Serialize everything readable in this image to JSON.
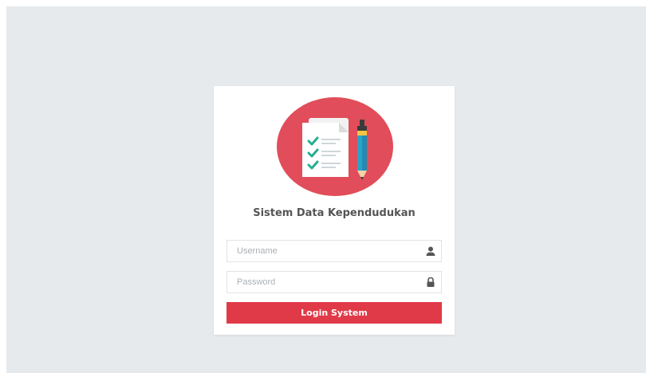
{
  "app": {
    "title": "Sistem Data Kependudukan"
  },
  "logo": {
    "icon": "checklist-pencil-icon",
    "color": "#e14d5a"
  },
  "form": {
    "username": {
      "placeholder": "Username",
      "value": "",
      "icon": "user-icon"
    },
    "password": {
      "placeholder": "Password",
      "value": "",
      "icon": "lock-icon"
    },
    "submit_label": "Login System"
  },
  "colors": {
    "accent": "#e03a48",
    "background": "#e6eaed",
    "card": "#ffffff"
  }
}
